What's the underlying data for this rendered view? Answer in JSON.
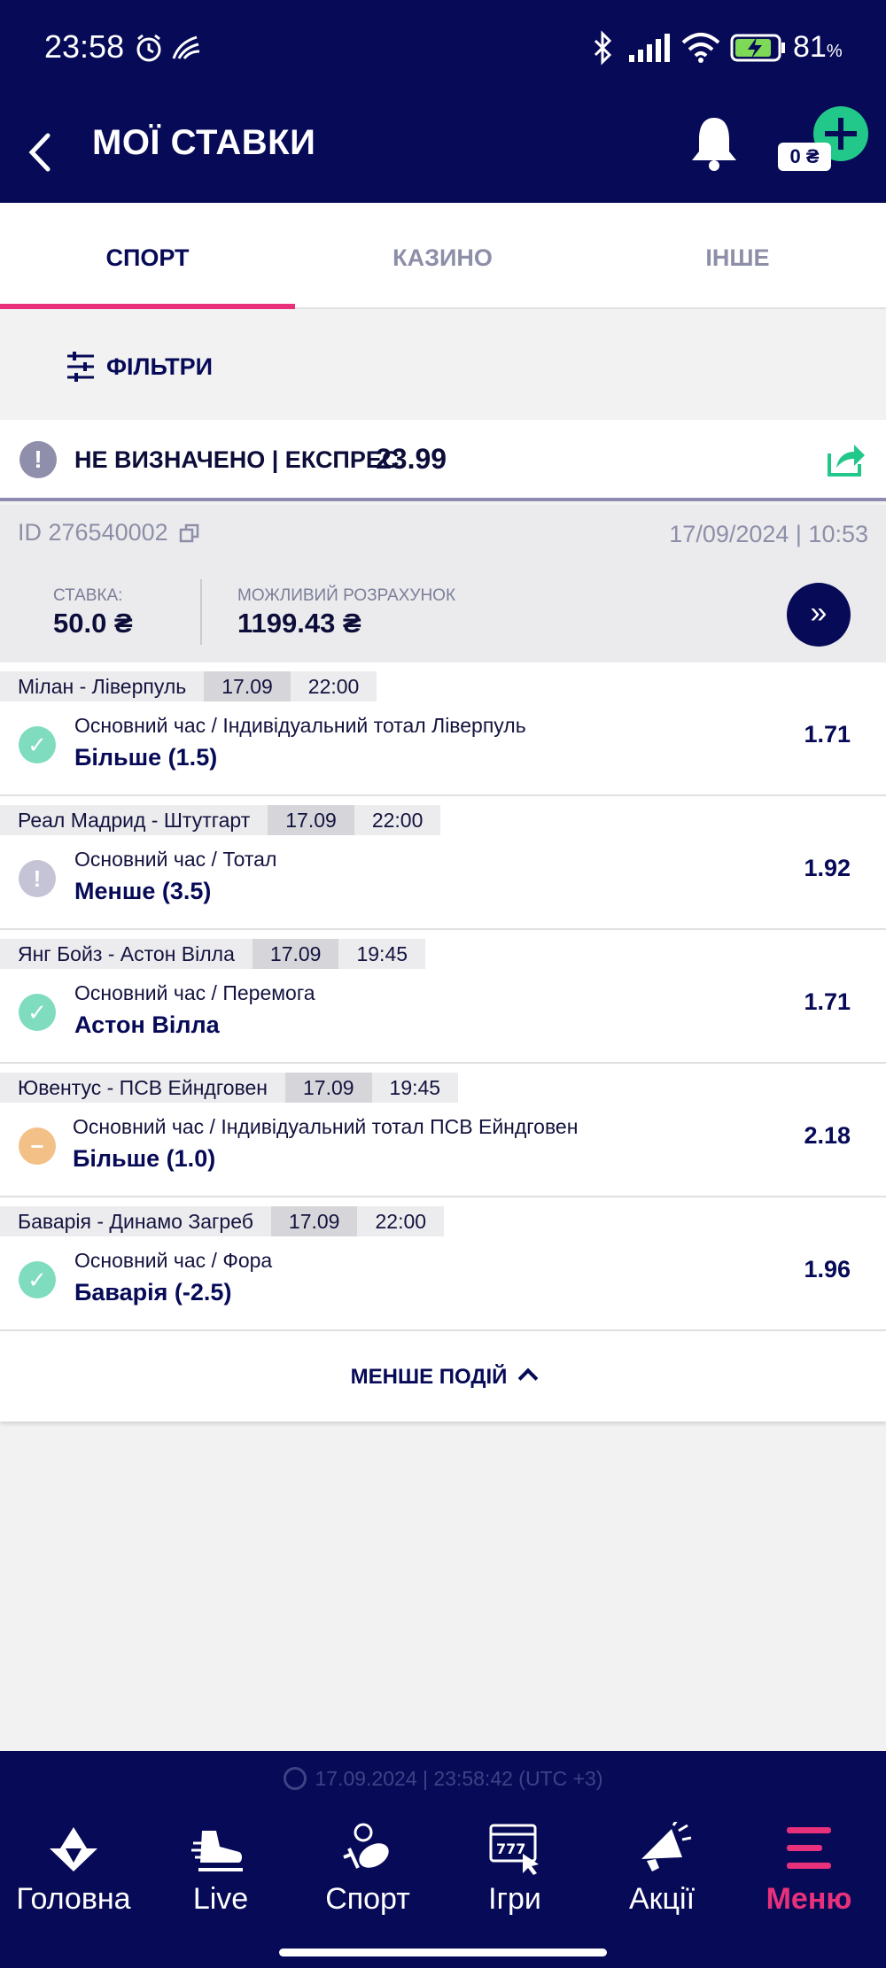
{
  "status_bar": {
    "time": "23:58",
    "battery": "81",
    "battery_unit": "%"
  },
  "header": {
    "title": "МОЇ СТАВКИ",
    "balance": "0 ₴"
  },
  "tabs": [
    {
      "label": "СПОРТ",
      "active": true
    },
    {
      "label": "КАЗИНО",
      "active": false
    },
    {
      "label": "ІНШЕ",
      "active": false
    }
  ],
  "filters": {
    "label": "ФІЛЬТРИ"
  },
  "bet": {
    "status_text": "НЕ ВИЗНАЧЕНО | ЕКСПРЕС",
    "total_odds": "23.99",
    "id": "ID 276540002",
    "datetime": "17/09/2024 | 10:53",
    "stake_label": "СТАВКА:",
    "stake_value": "50.0 ₴",
    "win_label": "МОЖЛИВИЙ РОЗРАХУНОК",
    "win_value": "1199.43 ₴",
    "more_label": "»",
    "events": [
      {
        "match": "Мілан - Ліверпуль",
        "date": "17.09",
        "time": "22:00",
        "status": "won",
        "market": "Основний час / Індивідуальний тотал Ліверпуль",
        "selection": "Більше (1.5)",
        "odds": "1.71"
      },
      {
        "match": "Реал Мадрид - Штутгарт",
        "date": "17.09",
        "time": "22:00",
        "status": "pending",
        "market": "Основний час / Тотал",
        "selection": "Менше (3.5)",
        "odds": "1.92"
      },
      {
        "match": "Янг Бойз - Астон Вілла",
        "date": "17.09",
        "time": "19:45",
        "status": "won",
        "market": "Основний час / Перемога",
        "selection": "Астон Вілла",
        "odds": "1.71"
      },
      {
        "match": "Ювентус - ПСВ Ейндговен",
        "date": "17.09",
        "time": "19:45",
        "status": "refund",
        "market": "Основний час / Індивідуальний тотал ПСВ Ейндговен",
        "selection": "Більше (1.0)",
        "odds": "2.18"
      },
      {
        "match": "Баварія - Динамо Загреб",
        "date": "17.09",
        "time": "22:00",
        "status": "won",
        "market": "Основний час / Фора",
        "selection": "Баварія (-2.5)",
        "odds": "1.96"
      }
    ],
    "less_events_label": "МЕНШЕ ПОДІЙ"
  },
  "footer": {
    "server_time": "17.09.2024 | 23:58:42 (UTC +3)",
    "nav": [
      {
        "label": "Головна",
        "icon": "home-icon",
        "active": false
      },
      {
        "label": "Live",
        "icon": "live-icon",
        "active": false
      },
      {
        "label": "Спорт",
        "icon": "sport-icon",
        "active": false
      },
      {
        "label": "Ігри",
        "icon": "games-icon",
        "active": false
      },
      {
        "label": "Акції",
        "icon": "promo-icon",
        "active": false
      },
      {
        "label": "Меню",
        "icon": "menu-icon",
        "active": true
      }
    ]
  },
  "colors": {
    "navy": "#070a57",
    "accent_pink": "#e8317a",
    "green": "#22c78a"
  }
}
